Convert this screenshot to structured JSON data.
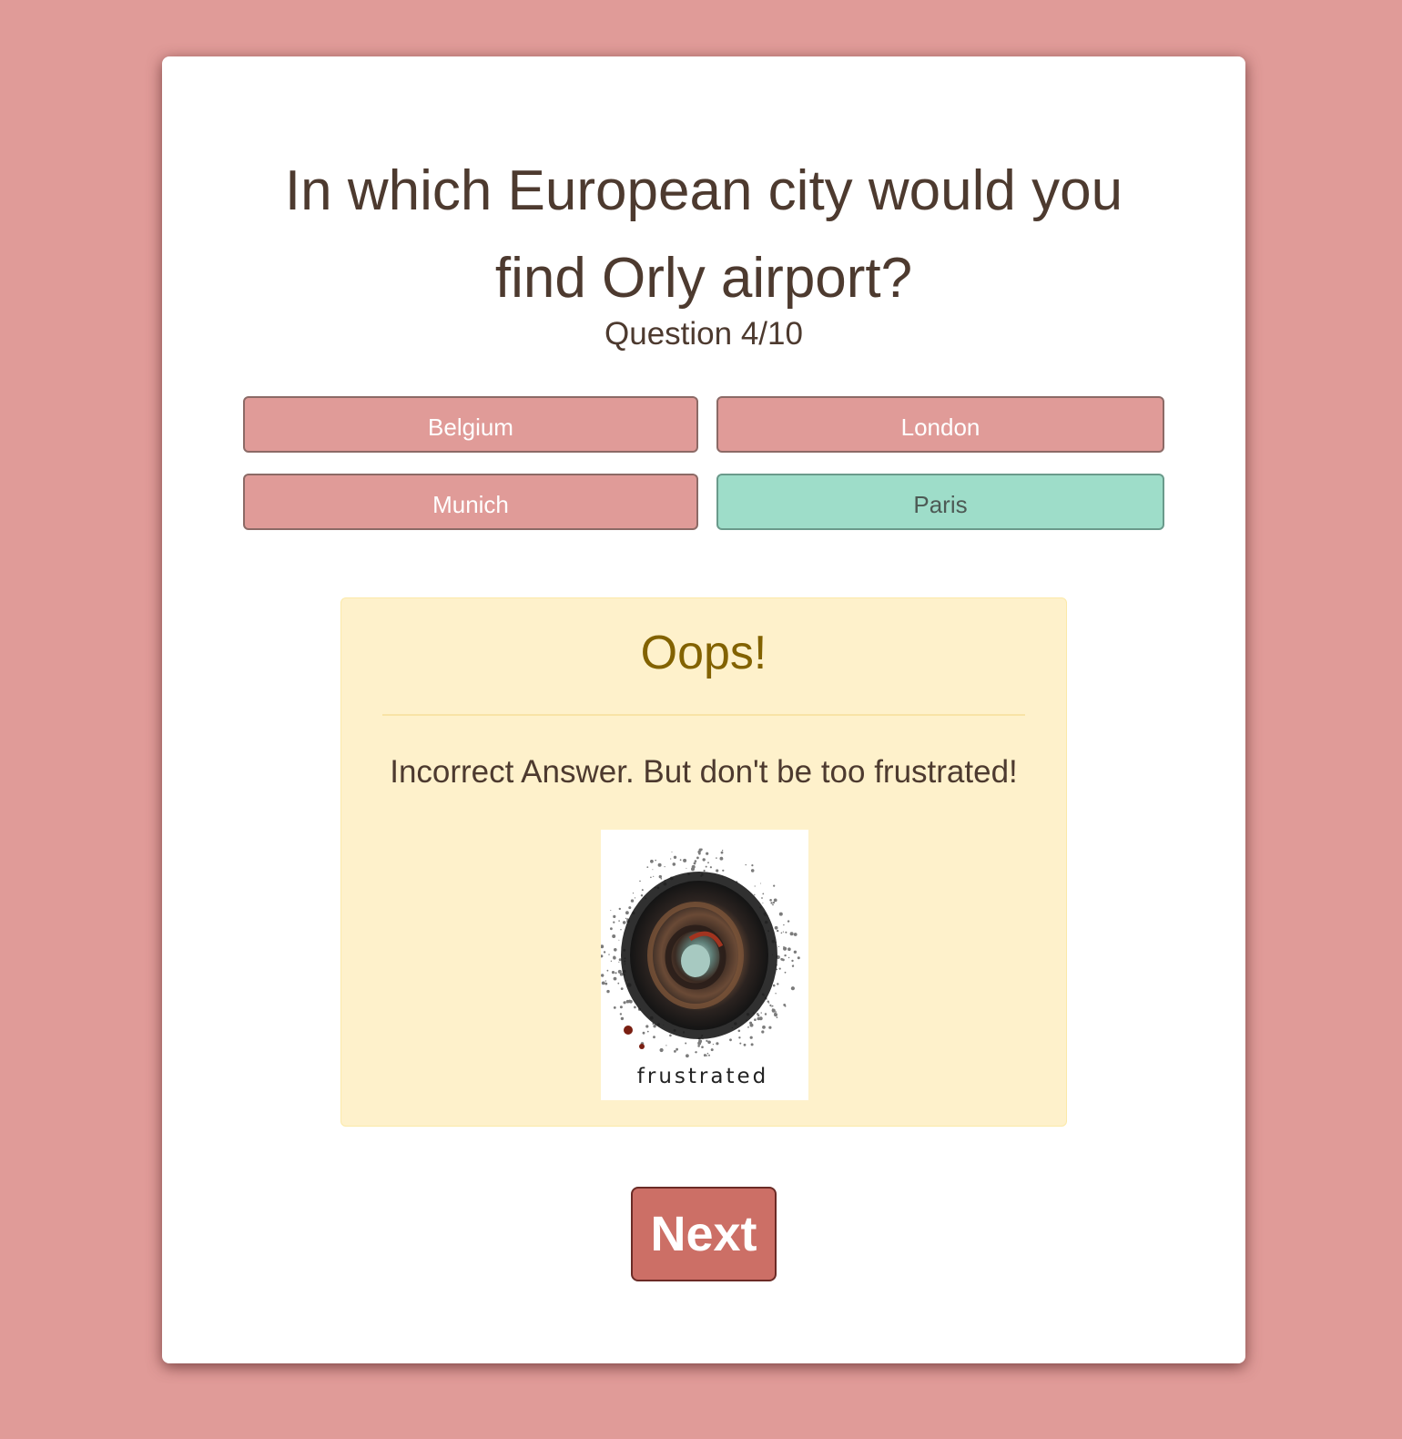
{
  "quiz": {
    "question": "In which European city would you find Orly airport?",
    "counter": "Question 4/10",
    "answers": [
      {
        "label": "Belgium",
        "state": "default"
      },
      {
        "label": "London",
        "state": "default"
      },
      {
        "label": "Munich",
        "state": "default"
      },
      {
        "label": "Paris",
        "state": "correct"
      }
    ],
    "next_label": "Next"
  },
  "feedback": {
    "title": "Oops!",
    "message": "Incorrect Answer. But don't be too frustrated!",
    "image_caption": "frustrated"
  },
  "colors": {
    "background": "#e09b98",
    "card": "#ffffff",
    "text": "#4d3a2f",
    "answer_default": "#e09b98",
    "answer_correct": "#9eddc9",
    "alert_bg": "#fef1cb",
    "alert_title": "#826200",
    "next_button": "#cc6f66"
  }
}
